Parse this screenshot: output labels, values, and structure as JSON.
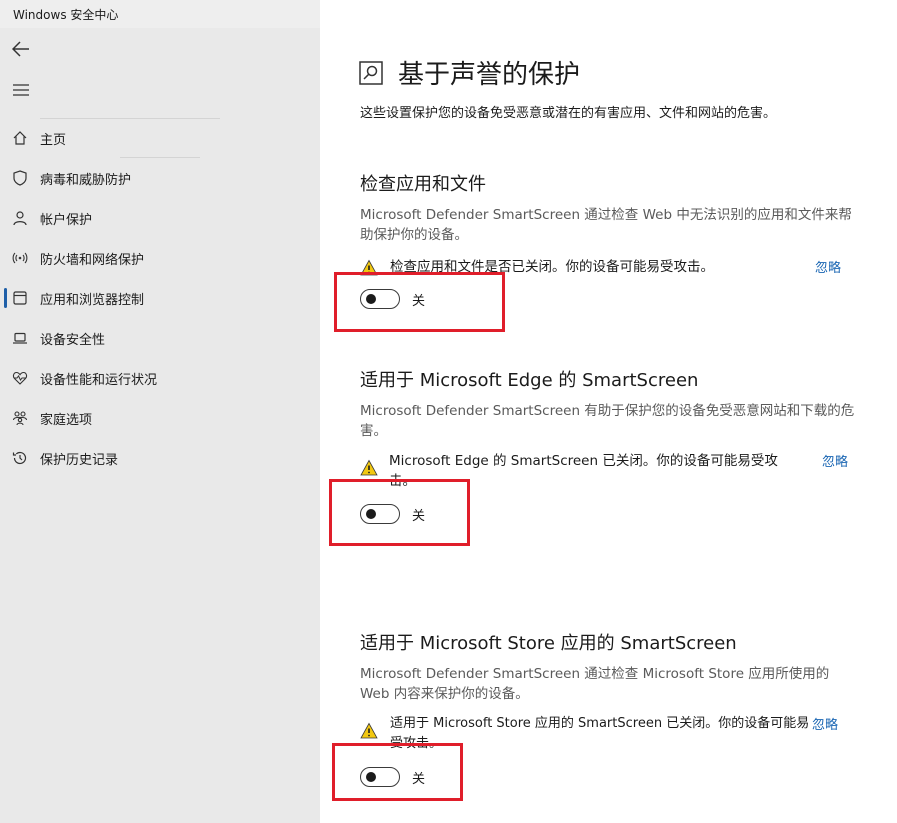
{
  "window": {
    "title": "Windows 安全中心"
  },
  "sidebar": {
    "items": [
      {
        "label": "主页",
        "icon": "home-icon"
      },
      {
        "label": "病毒和威胁防护",
        "icon": "shield-icon"
      },
      {
        "label": "帐户保护",
        "icon": "person-icon"
      },
      {
        "label": "防火墙和网络保护",
        "icon": "wifi-antenna-icon"
      },
      {
        "label": "应用和浏览器控制",
        "icon": "app-browser-icon",
        "active": true
      },
      {
        "label": "设备安全性",
        "icon": "laptop-icon"
      },
      {
        "label": "设备性能和运行状况",
        "icon": "heart-pulse-icon"
      },
      {
        "label": "家庭选项",
        "icon": "family-icon"
      },
      {
        "label": "保护历史记录",
        "icon": "history-icon"
      }
    ]
  },
  "main": {
    "title": "基于声誉的保护",
    "description": "这些设置保护您的设备免受恶意或潜在的有害应用、文件和网站的危害。",
    "sections": [
      {
        "title": "检查应用和文件",
        "description": "Microsoft Defender SmartScreen 通过检查 Web 中无法识别的应用和文件来帮助保护你的设备。",
        "warning": "检查应用和文件是否已关闭。你的设备可能易受攻击。",
        "ignore": "忽略",
        "toggle_label": "关",
        "toggle_on": false
      },
      {
        "title": "适用于 Microsoft Edge 的 SmartScreen",
        "description": "Microsoft Defender SmartScreen 有助于保护您的设备免受恶意网站和下载的危害。",
        "warning": "Microsoft Edge 的 SmartScreen 已关闭。你的设备可能易受攻击。",
        "ignore": "忽略",
        "toggle_label": "关",
        "toggle_on": false
      },
      {
        "title": "适用于 Microsoft Store 应用的 SmartScreen",
        "description": "Microsoft Defender SmartScreen 通过检查 Microsoft Store 应用所使用的 Web 内容来保护你的设备。",
        "warning": "适用于 Microsoft Store 应用的 SmartScreen 已关闭。你的设备可能易受攻击。",
        "ignore": "忽略",
        "toggle_label": "关",
        "toggle_on": false
      }
    ]
  },
  "colors": {
    "accent": "#1f5fa8",
    "link": "#1a66b3",
    "highlight": "#e01e2a",
    "warning": "#f2c811"
  }
}
